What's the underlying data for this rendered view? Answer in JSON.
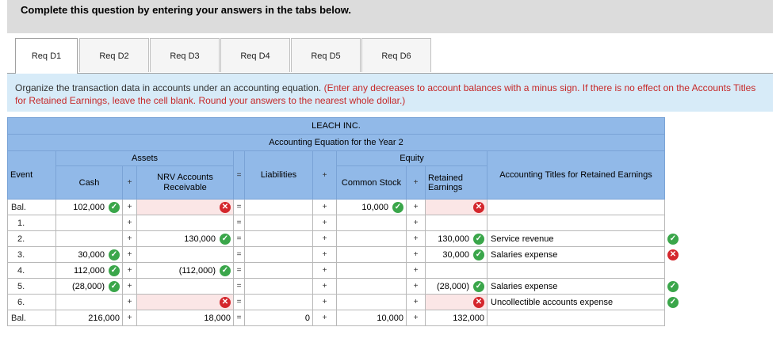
{
  "banner": "Complete this question by entering your answers in the tabs below.",
  "tabs": [
    "Req D1",
    "Req D2",
    "Req D3",
    "Req D4",
    "Req D5",
    "Req D6"
  ],
  "instruction": "Organize the transaction data in accounts under an accounting equation.",
  "instruction_hint": "(Enter any decreases to account balances with a minus sign. If there is no effect on the Accounts Titles for Retained Earnings, leave the cell blank. Round your answers to the nearest whole dollar.)",
  "table": {
    "company": "LEACH INC.",
    "subtitle": "Accounting Equation for the Year 2",
    "assets": "Assets",
    "equity": "Equity",
    "event": "Event",
    "cash": "Cash",
    "plus": "+",
    "eq": "=",
    "nrv": "NRV Accounts Receivable",
    "liabilities": "Liabilities",
    "common_stock": "Common Stock",
    "retained": "Retained Earnings",
    "titles": "Accounting Titles for Retained Earnings"
  },
  "rows": [
    {
      "event": "Bal.",
      "cash": "102,000",
      "cash_s": "ok",
      "nrv": "",
      "nrv_s": "bad",
      "liab": "",
      "cs": "10,000",
      "cs_s": "ok",
      "re": "",
      "re_s": "bad",
      "title": "",
      "title_s": ""
    },
    {
      "event": "1.",
      "cash": "",
      "cash_s": "",
      "nrv": "",
      "nrv_s": "",
      "liab": "",
      "cs": "",
      "cs_s": "",
      "re": "",
      "re_s": "",
      "title": "",
      "title_s": ""
    },
    {
      "event": "2.",
      "cash": "",
      "cash_s": "",
      "nrv": "130,000",
      "nrv_s": "ok",
      "liab": "",
      "cs": "",
      "cs_s": "",
      "re": "130,000",
      "re_s": "ok",
      "title": "Service revenue",
      "title_s": "ok"
    },
    {
      "event": "3.",
      "cash": "30,000",
      "cash_s": "ok",
      "nrv": "",
      "nrv_s": "",
      "liab": "",
      "cs": "",
      "cs_s": "",
      "re": "30,000",
      "re_s": "ok",
      "title": "Salaries expense",
      "title_s": "bad"
    },
    {
      "event": "4.",
      "cash": "112,000",
      "cash_s": "ok",
      "nrv": "(112,000)",
      "nrv_s": "ok",
      "liab": "",
      "cs": "",
      "cs_s": "",
      "re": "",
      "re_s": "",
      "title": "",
      "title_s": ""
    },
    {
      "event": "5.",
      "cash": "(28,000)",
      "cash_s": "ok",
      "nrv": "",
      "nrv_s": "",
      "liab": "",
      "cs": "",
      "cs_s": "",
      "re": "(28,000)",
      "re_s": "ok",
      "title": "Salaries expense",
      "title_s": "ok"
    },
    {
      "event": "6.",
      "cash": "",
      "cash_s": "",
      "nrv": "",
      "nrv_s": "bad",
      "liab": "",
      "cs": "",
      "cs_s": "",
      "re": "",
      "re_s": "bad",
      "title": "Uncollectible accounts expense",
      "title_s": "ok"
    },
    {
      "event": "Bal.",
      "cash": "216,000",
      "cash_s": "",
      "nrv": "18,000",
      "nrv_s": "",
      "liab": "0",
      "cs": "10,000",
      "cs_s": "",
      "re": "132,000",
      "re_s": "",
      "title": "",
      "title_s": ""
    }
  ]
}
